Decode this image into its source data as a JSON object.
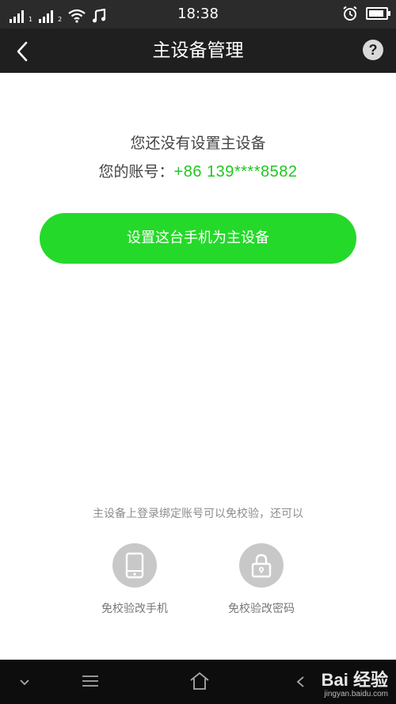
{
  "status_bar": {
    "sim1_label": "1",
    "sim2_label": "2",
    "time": "18:38",
    "battery_level": 0.9,
    "icons": [
      "signal-icon",
      "wifi-icon",
      "music-icon",
      "alarm-icon",
      "battery-icon"
    ]
  },
  "nav": {
    "title": "主设备管理",
    "help_label": "?"
  },
  "main": {
    "message": "您还没有设置主设备",
    "account_label": "您的账号：",
    "account_number": "+86 139****8582",
    "primary_button_label": "设置这台手机为主设备"
  },
  "footer": {
    "hint": "主设备上登录绑定账号可以免校验，还可以",
    "features": [
      {
        "label": "免校验改手机",
        "icon": "phone-icon"
      },
      {
        "label": "免校验改密码",
        "icon": "lock-icon"
      }
    ]
  },
  "system_nav": {
    "watermark_brand": "Bai 经验",
    "watermark_url": "jingyan.baidu.com"
  },
  "colors": {
    "accent_green": "#25d92a",
    "phone_green": "#21c621",
    "header_dark": "#1f1f1f"
  }
}
